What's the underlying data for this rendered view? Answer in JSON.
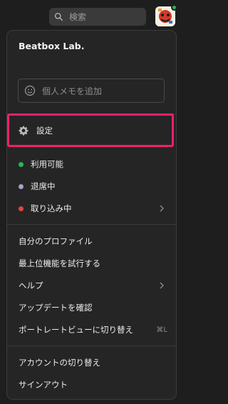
{
  "search": {
    "placeholder": "検索"
  },
  "menu": {
    "title": "Beatbox Lab.",
    "memo_placeholder": "個人メモを追加",
    "settings_label": "設定",
    "status": [
      {
        "label": "利用可能",
        "color": "#2bb45a"
      },
      {
        "label": "退席中",
        "color": "#9aa0c8"
      },
      {
        "label": "取り込み中",
        "color": "#e0493a"
      }
    ],
    "section2": [
      "自分のプロファイル",
      "最上位機能を試行する",
      "ヘルプ",
      "アップデートを確認",
      "ポートレートビューに切り替え"
    ],
    "shortcut": "⌘L",
    "section3": [
      "アカウントの切り替え",
      "サインアウト"
    ]
  },
  "colors": {
    "highlight": "#f0206a",
    "presence": "#2bb45a"
  }
}
